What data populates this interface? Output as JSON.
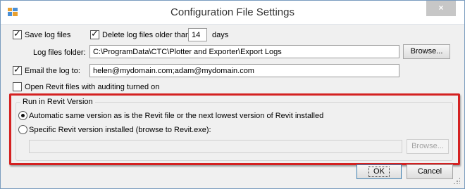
{
  "window": {
    "title": "Configuration File Settings",
    "close_glyph": "×"
  },
  "logging": {
    "save_log_files": {
      "label": "Save log files",
      "checked": true
    },
    "delete_logs": {
      "label": "Delete log files older than",
      "checked": true,
      "days_value": "14",
      "days_suffix": "days"
    },
    "log_folder": {
      "label": "Log files folder:",
      "value": "C:\\ProgramData\\CTC\\Plotter and Exporter\\Export Logs",
      "browse_label": "Browse..."
    },
    "email_log": {
      "label": "Email the log to:",
      "checked": true,
      "value": "helen@mydomain.com;adam@mydomain.com"
    },
    "open_revit_auditing": {
      "label": "Open Revit files with auditing turned on",
      "checked": false
    }
  },
  "revit_version": {
    "group_title": "Run in Revit Version",
    "automatic": {
      "label": "Automatic same version as is the Revit file or the next lowest version of Revit installed",
      "selected": true
    },
    "specific": {
      "label": "Specific Revit version installed (browse to Revit.exe):",
      "selected": false
    },
    "path_value": "",
    "browse_label": "Browse..."
  },
  "footer": {
    "ok_label": "OK",
    "cancel_label": "Cancel"
  },
  "colors": {
    "highlight": "#d42121",
    "close_button": "#c7c7c7"
  },
  "icons": [
    "app-icon",
    "close-icon",
    "checkbox",
    "radio",
    "resize-grip-icon"
  ]
}
